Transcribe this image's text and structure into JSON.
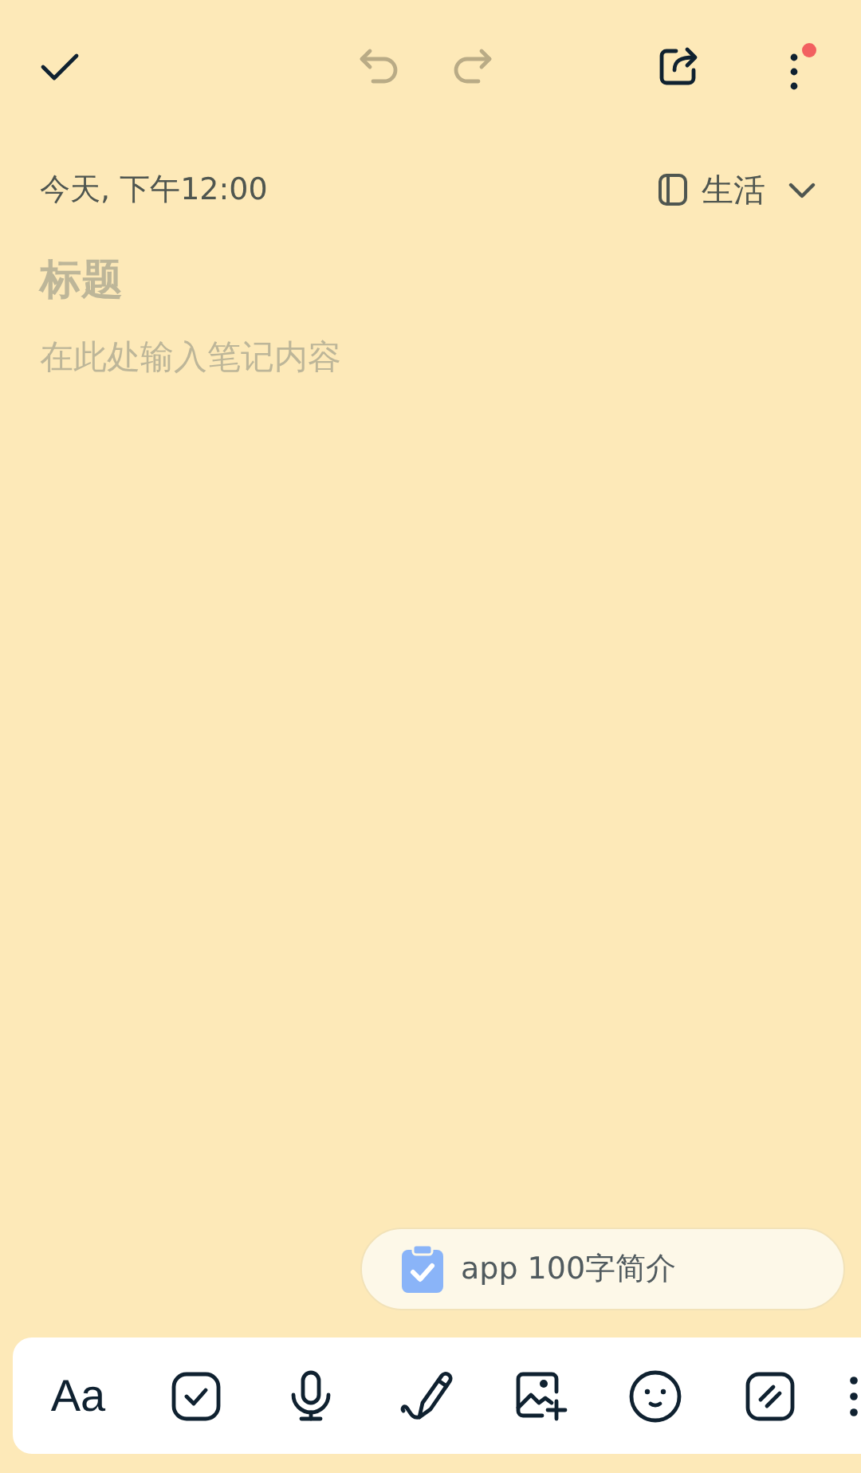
{
  "top_bar": {
    "undo": {
      "disabled": true
    },
    "redo": {
      "disabled": true
    },
    "more": {
      "badge": true
    }
  },
  "note": {
    "timestamp": "今天, 下午12:00",
    "folder": "生活",
    "title_placeholder": "标题",
    "body_placeholder": "在此处输入笔记内容"
  },
  "suggestion": {
    "text": "app 100字简介"
  },
  "toolbar": [
    {
      "kind": "text",
      "label": "Aa"
    },
    {
      "kind": "checklist"
    },
    {
      "kind": "voice"
    },
    {
      "kind": "handwriting"
    },
    {
      "kind": "image"
    },
    {
      "kind": "emoji"
    },
    {
      "kind": "format"
    },
    {
      "kind": "more"
    }
  ]
}
